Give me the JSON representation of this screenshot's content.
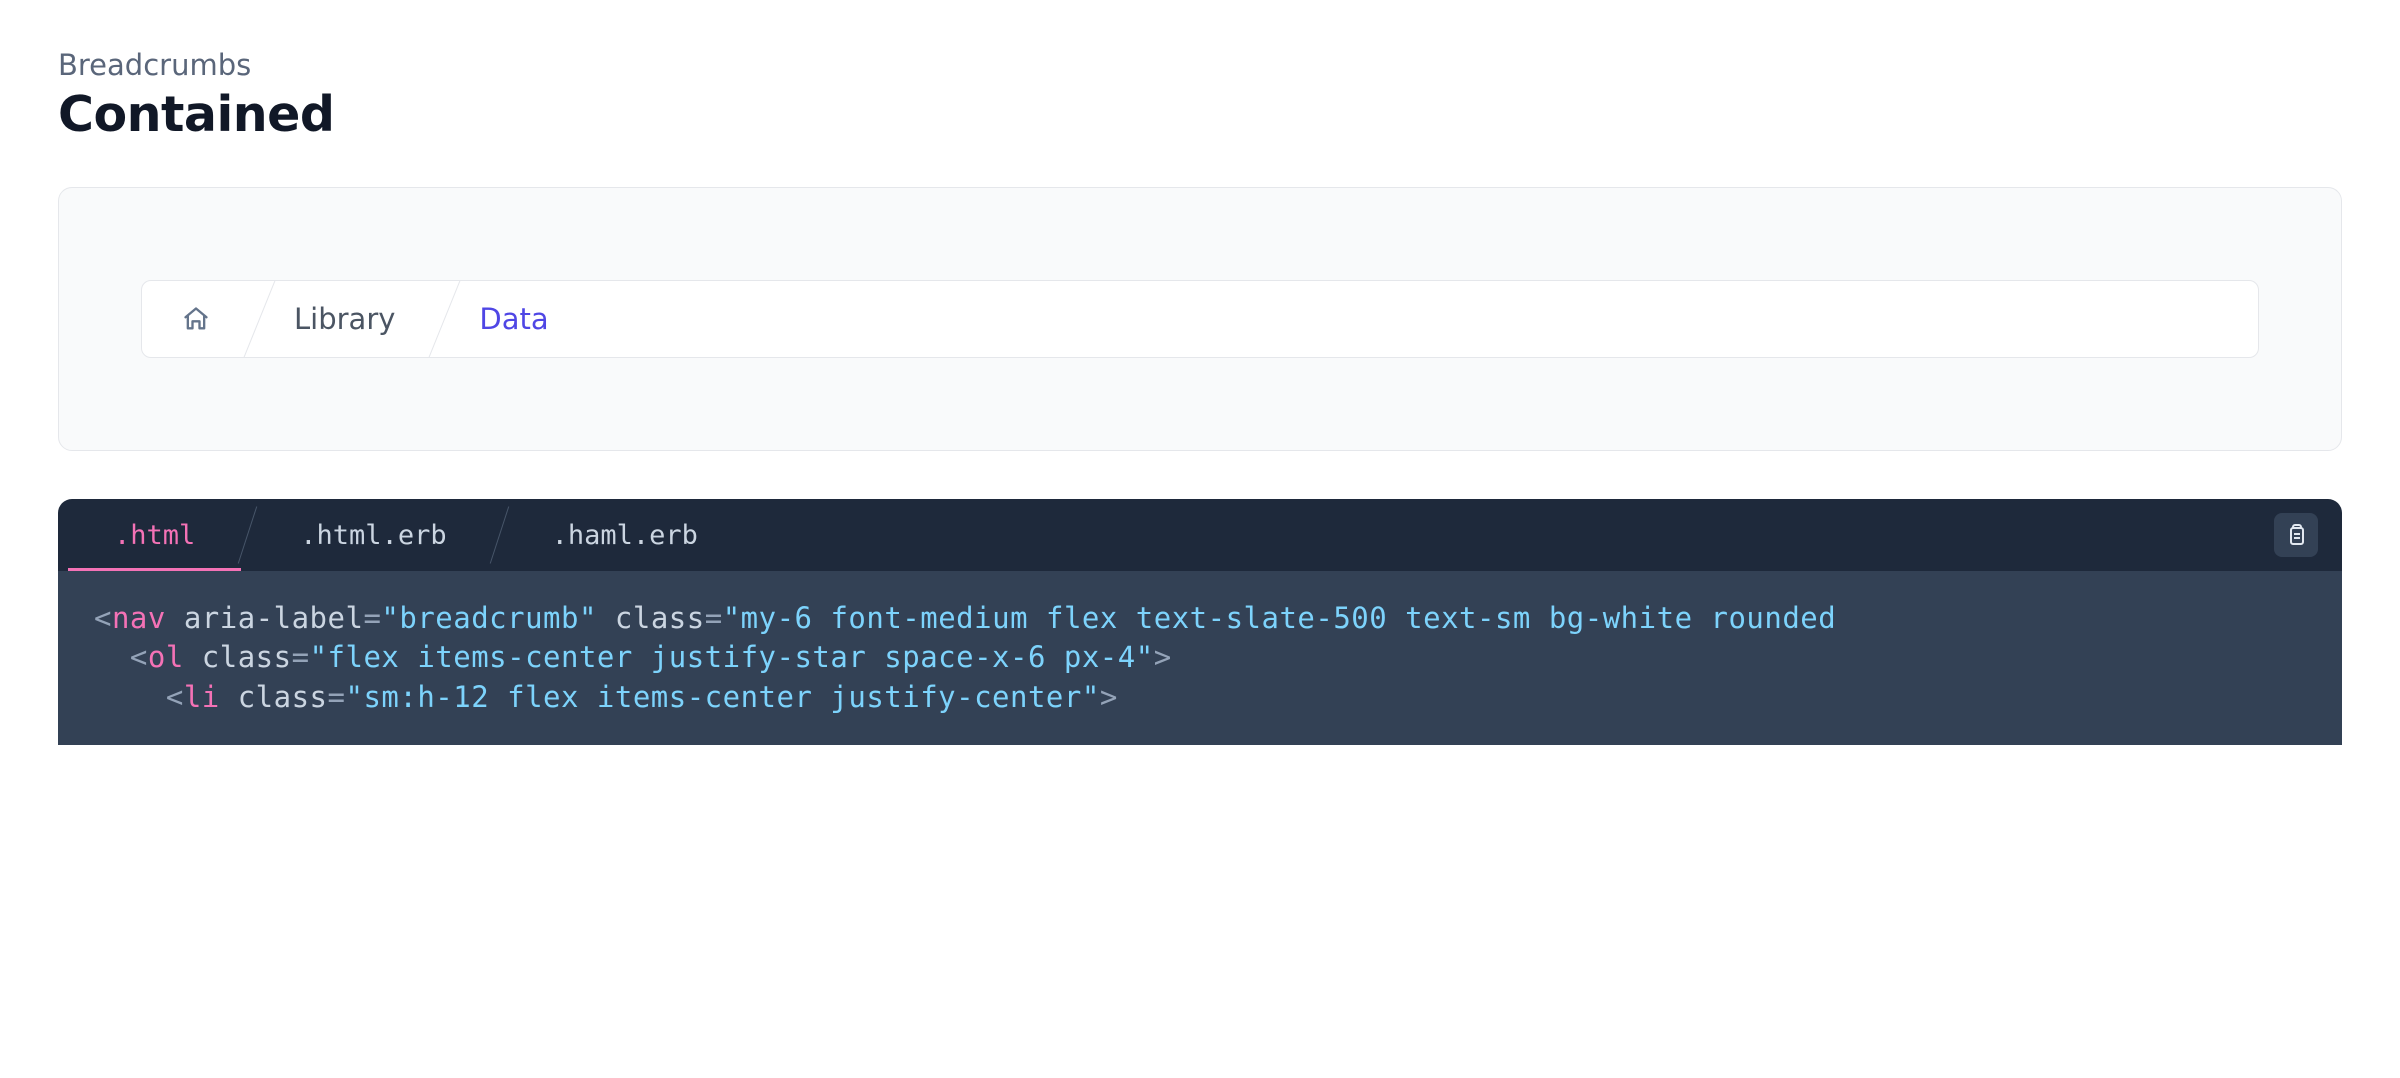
{
  "header": {
    "category": "Breadcrumbs",
    "title": "Contained"
  },
  "breadcrumb": {
    "home": "Home",
    "items": [
      {
        "label": "Library",
        "active": false
      },
      {
        "label": "Data",
        "active": true
      }
    ]
  },
  "code_tabs": [
    {
      "label": ".html",
      "active": true
    },
    {
      "label": ".html.erb",
      "active": false
    },
    {
      "label": ".haml.erb",
      "active": false
    }
  ],
  "code": {
    "line1": {
      "tag": "nav",
      "attr1": "aria-label",
      "val1": "breadcrumb",
      "attr2": "class",
      "val2": "my-6 font-medium flex text-slate-500 text-sm bg-white rounded"
    },
    "line2": {
      "tag": "ol",
      "attr1": "class",
      "val1": "flex items-center justify-star space-x-6 px-4"
    },
    "line3": {
      "tag": "li",
      "attr1": "class",
      "val1": "sm:h-12 flex items-center justify-center"
    }
  }
}
